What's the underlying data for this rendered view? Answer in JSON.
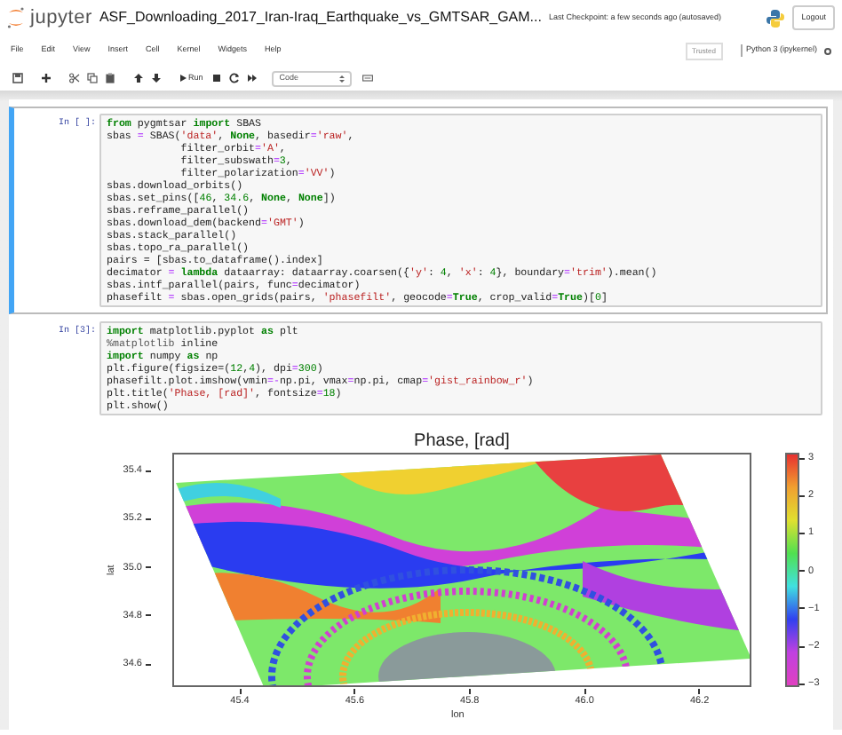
{
  "header": {
    "logo_text": "jupyter",
    "notebook_title": "ASF_Downloading_2017_Iran-Iraq_Earthquake_vs_GMTSAR_GAM...",
    "checkpoint": "Last Checkpoint: a few seconds ago",
    "autosave": "(autosaved)",
    "logout": "Logout"
  },
  "menu": [
    "File",
    "Edit",
    "View",
    "Insert",
    "Cell",
    "Kernel",
    "Widgets",
    "Help"
  ],
  "trusted": "Trusted",
  "kernel": "Python 3 (ipykernel)",
  "toolbar": {
    "run": "Run",
    "cell_type": "Code"
  },
  "cells": [
    {
      "prompt": "In [ ]:",
      "selected": true,
      "lines": [
        "from pygmtsar import SBAS",
        "sbas = SBAS('data', None, basedir='raw',",
        "            filter_orbit='A',",
        "            filter_subswath=3,",
        "            filter_polarization='VV')",
        "sbas.download_orbits()",
        "sbas.set_pins([46, 34.6, None, None])",
        "sbas.reframe_parallel()",
        "sbas.download_dem(backend='GMT')",
        "sbas.stack_parallel()",
        "sbas.topo_ra_parallel()",
        "pairs = [sbas.to_dataframe().index]",
        "decimator = lambda dataarray: dataarray.coarsen({'y': 4, 'x': 4}, boundary='trim').mean()",
        "sbas.intf_parallel(pairs, func=decimator)",
        "phasefilt = sbas.open_grids(pairs, 'phasefilt', geocode=True, crop_valid=True)[0]"
      ]
    },
    {
      "prompt": "In [3]:",
      "selected": false,
      "lines": [
        "import matplotlib.pyplot as plt",
        "%matplotlib inline",
        "import numpy as np",
        "plt.figure(figsize=(12,4), dpi=300)",
        "phasefilt.plot.imshow(vmin=-np.pi, vmax=np.pi, cmap='gist_rainbow_r')",
        "plt.title('Phase, [rad]', fontsize=18)",
        "plt.show()"
      ],
      "output": {
        "title": "Phase, [rad]",
        "xlabel": "lon",
        "ylabel": "lat",
        "xticks": [
          "45.4",
          "45.6",
          "45.8",
          "46.0",
          "46.2"
        ],
        "yticks": [
          "35.4",
          "35.2",
          "35.0",
          "34.8",
          "34.6"
        ],
        "colorbar_ticks": [
          "3",
          "2",
          "1",
          "0",
          "−1",
          "−2",
          "−3"
        ]
      }
    }
  ]
}
